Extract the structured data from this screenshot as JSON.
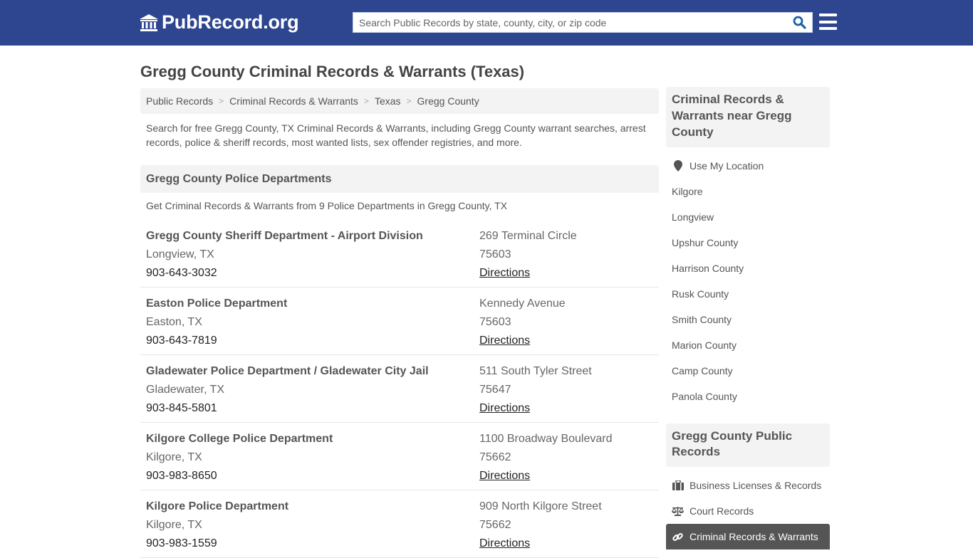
{
  "header": {
    "logo_text": "PubRecord.org",
    "logo_icon": "bank-building-icon",
    "search_placeholder": "Search Public Records by state, county, city, or zip code",
    "search_value": "",
    "search_icon": "search-icon",
    "menu_icon": "hamburger-menu-icon"
  },
  "colors": {
    "header_bg": "#2e4690",
    "panel_bg": "#f3f3f3",
    "active_item_bg": "#555555",
    "search_icon": "#1e5fa8"
  },
  "page": {
    "title": "Gregg County Criminal Records & Warrants (Texas)",
    "breadcrumb": [
      {
        "label": "Public Records"
      },
      {
        "label": "Criminal Records & Warrants"
      },
      {
        "label": "Texas"
      },
      {
        "label": "Gregg County"
      }
    ],
    "breadcrumb_separator": ">",
    "intro": "Search for free Gregg County, TX Criminal Records & Warrants, including Gregg County warrant searches, arrest records, police & sheriff records, most wanted lists, sex offender registries, and more."
  },
  "police_section": {
    "heading": "Gregg County Police Departments",
    "subtitle": "Get Criminal Records & Warrants from 9 Police Departments in Gregg County, TX",
    "listings": [
      {
        "name": "Gregg County Sheriff Department - Airport Division",
        "city": "Longview, TX",
        "phone": "903-643-3032",
        "address": "269 Terminal Circle",
        "zip": "75603",
        "directions": "Directions"
      },
      {
        "name": "Easton Police Department",
        "city": "Easton, TX",
        "phone": "903-643-7819",
        "address": "Kennedy Avenue",
        "zip": "75603",
        "directions": "Directions"
      },
      {
        "name": "Gladewater Police Department / Gladewater City Jail",
        "city": "Gladewater, TX",
        "phone": "903-845-5801",
        "address": "511 South Tyler Street",
        "zip": "75647",
        "directions": "Directions"
      },
      {
        "name": "Kilgore College Police Department",
        "city": "Kilgore, TX",
        "phone": "903-983-8650",
        "address": "1100 Broadway Boulevard",
        "zip": "75662",
        "directions": "Directions"
      },
      {
        "name": "Kilgore Police Department",
        "city": "Kilgore, TX",
        "phone": "903-983-1559",
        "address": "909 North Kilgore Street",
        "zip": "75662",
        "directions": "Directions"
      }
    ]
  },
  "sidebar": {
    "nearby_heading": "Criminal Records & Warrants near Gregg County",
    "use_location": {
      "label": "Use My Location",
      "icon": "map-marker-icon"
    },
    "nearby": [
      {
        "label": "Kilgore"
      },
      {
        "label": "Longview"
      },
      {
        "label": "Upshur County"
      },
      {
        "label": "Harrison County"
      },
      {
        "label": "Rusk County"
      },
      {
        "label": "Smith County"
      },
      {
        "label": "Marion County"
      },
      {
        "label": "Camp County"
      },
      {
        "label": "Panola County"
      }
    ],
    "records_heading": "Gregg County Public Records",
    "records": [
      {
        "label": "Business Licenses & Records",
        "icon": "briefcase-icon",
        "active": false
      },
      {
        "label": "Court Records",
        "icon": "balance-scale-icon",
        "active": false
      },
      {
        "label": "Criminal Records & Warrants",
        "icon": "link-icon",
        "active": true
      }
    ]
  }
}
